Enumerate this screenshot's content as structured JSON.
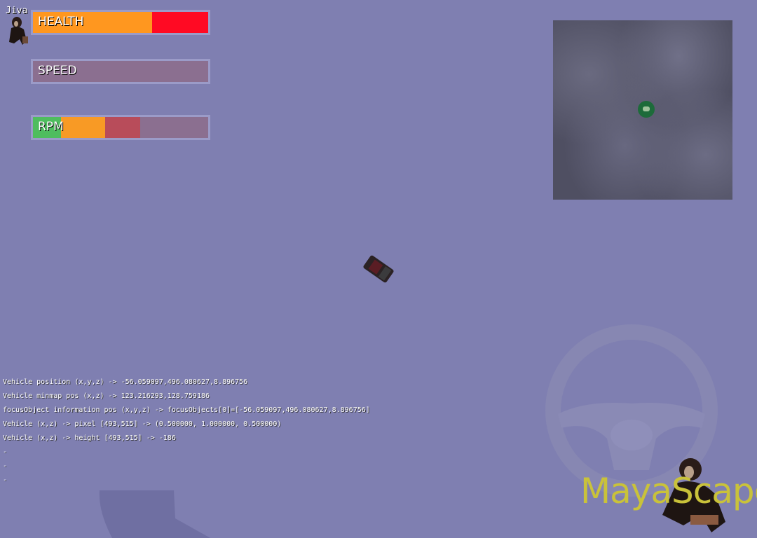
{
  "player": {
    "name": "Jiva"
  },
  "hud": {
    "health": {
      "label": "HEALTH",
      "value": 0.68,
      "color_fill": "#ff971f",
      "color_empty": "#ff0a23"
    },
    "speed": {
      "label": "SPEED",
      "value": 0
    },
    "rpm": {
      "label": "RPM",
      "segments": [
        0.16,
        0.25,
        0.2
      ]
    }
  },
  "debug": [
    "Vehicle position (x,y,z) -> -56.059097,496.080627,8.896756",
    "Vehicle minmap pos (x,z) -> 123.216293,128.759186",
    "focusObject information pos (x,y,z) -> focusObjects[0]=[-56.059097,496.080627,8.896756]",
    "Vehicle (x,z) -> pixel [493,515] -> (0.500000, 1.000000, 0.500000)",
    "Vehicle (x,z) -> height [493,515] -> -186",
    "-",
    "-",
    "-"
  ],
  "logo": {
    "text": "MayaScape",
    "color": "#c9c23a"
  }
}
